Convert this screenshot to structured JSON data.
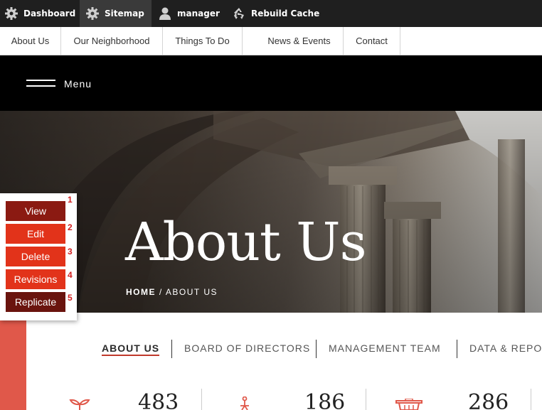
{
  "admin_bar": {
    "items": [
      {
        "label": "Dashboard",
        "icon": "gear-icon"
      },
      {
        "label": "Sitemap",
        "icon": "gear-icon"
      },
      {
        "label": "manager",
        "icon": "user-icon"
      },
      {
        "label": "Rebuild Cache",
        "icon": "recycle-icon"
      }
    ]
  },
  "sub_nav": {
    "items": [
      "About Us",
      "Our Neighborhood",
      "Things To Do",
      "News & Events",
      "Contact"
    ]
  },
  "header": {
    "menu_label": "Menu"
  },
  "hero": {
    "title": "About Us",
    "breadcrumb": {
      "home": "HOME",
      "separator": "/",
      "current": "ABOUT US"
    }
  },
  "section_tabs": {
    "items": [
      "ABOUT US",
      "BOARD OF DIRECTORS",
      "MANAGEMENT TEAM",
      "DATA & REPOR"
    ],
    "active": "ABOUT US"
  },
  "stats": [
    {
      "icon": "sprout-icon",
      "value": "483"
    },
    {
      "icon": "person-icon",
      "value": "186"
    },
    {
      "icon": "trash-icon",
      "value": "286"
    }
  ],
  "context_menu": {
    "buttons": [
      {
        "label": "View",
        "number": "1"
      },
      {
        "label": "Edit",
        "number": "2"
      },
      {
        "label": "Delete",
        "number": "3"
      },
      {
        "label": "Revisions",
        "number": "4"
      },
      {
        "label": "Replicate",
        "number": "5"
      }
    ]
  },
  "colors": {
    "admin_bar": "#1f1f1f",
    "accent_red": "#e0584a",
    "button_dark_red": "#8b1a12",
    "button_red": "#e2331a",
    "number_red": "#d21f1f"
  }
}
